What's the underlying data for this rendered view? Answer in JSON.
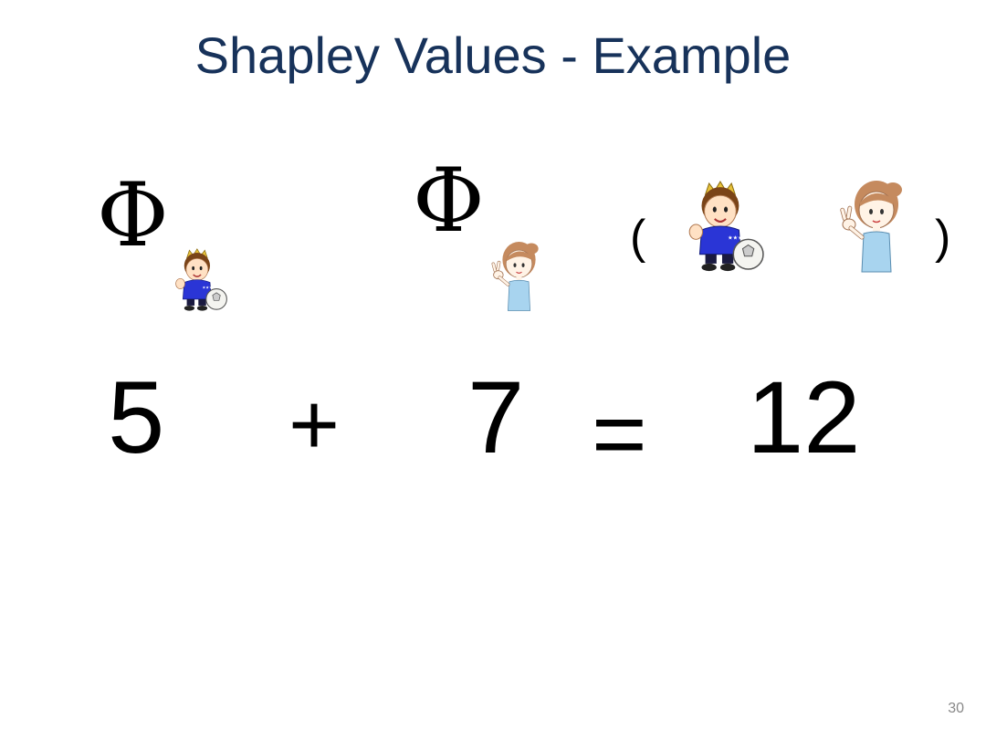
{
  "slide": {
    "title": "Shapley Values - Example",
    "page_number": "30"
  },
  "equation_top": {
    "phi_symbol": "Φ",
    "open_paren": "(",
    "close_paren": ")",
    "players": [
      {
        "name": "boy-soccer-player-icon"
      },
      {
        "name": "girl-peace-sign-icon"
      }
    ]
  },
  "equation_bottom": {
    "term1": "5",
    "plus": "+",
    "term2": "7",
    "equals": "=",
    "total": "12"
  },
  "colors": {
    "title": "#17325a",
    "boy_shirt": "#2a35d6",
    "girl_top": "#a8d4ef",
    "hair_girl": "#c58a5e",
    "hair_boy": "#7a4418",
    "skin": "#ffe1c4"
  }
}
